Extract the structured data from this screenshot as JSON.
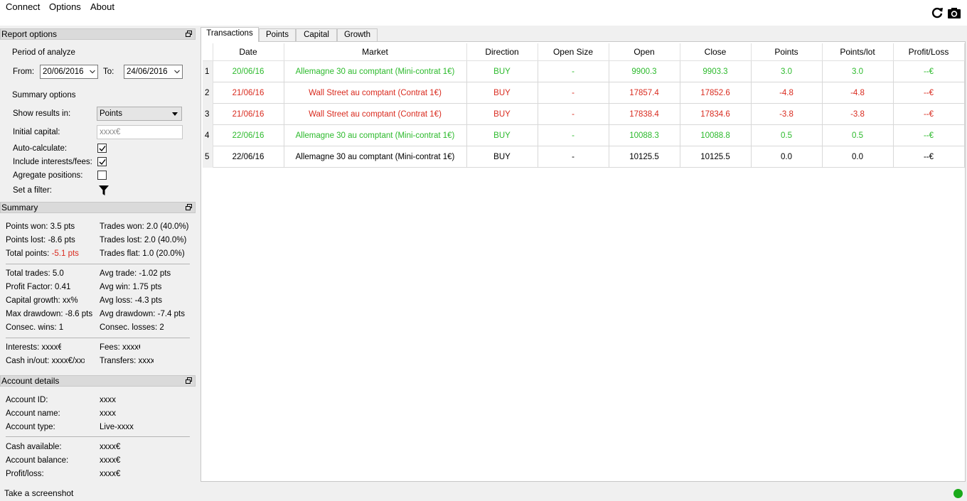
{
  "menu": {
    "connect": "Connect",
    "options": "Options",
    "about": "About"
  },
  "toolbar": {
    "refresh_icon": "refresh-icon",
    "screenshot_icon": "camera-icon"
  },
  "report_options": {
    "header": "Report options",
    "period_label": "Period of analyze",
    "from_label": "From:",
    "from_value": "20/06/2016",
    "to_label": "To:",
    "to_value": "24/06/2016",
    "summary_options_label": "Summary options",
    "show_results_label": "Show results in:",
    "show_results_value": "Points",
    "initial_capital_label": "Initial capital:",
    "initial_capital_placeholder": "xxxx€",
    "auto_calculate_label": "Auto-calculate:",
    "auto_calculate_checked": true,
    "include_interests_label": "Include interests/fees:",
    "include_interests_checked": true,
    "aggregate_label": "Agregate positions:",
    "aggregate_checked": false,
    "filter_label": "Set a filter:"
  },
  "summary": {
    "header": "Summary",
    "points_won": "Points won: 3.5 pts",
    "trades_won": "Trades won: 2.0 (40.0%)",
    "points_lost": "Points lost: -8.6 pts",
    "trades_lost": "Trades lost: 2.0 (40.0%)",
    "total_points_label": "Total points:",
    "total_points_value": "-5.1 pts",
    "trades_flat": "Trades flat: 1.0 (20.0%)",
    "total_trades": "Total trades: 5.0",
    "avg_trade": "Avg trade: -1.02 pts",
    "profit_factor": "Profit Factor: 0.41",
    "avg_win": "Avg win: 1.75 pts",
    "capital_growth": "Capital growth: xx%",
    "avg_loss": "Avg loss: -4.3 pts",
    "max_drawdown": "Max drawdown: -8.6 pts",
    "avg_drawdown": "Avg drawdown: -7.4 pts",
    "consec_wins": "Consec. wins: 1",
    "consec_losses": "Consec. losses: 2",
    "interests": "Interests: xxxx€",
    "fees": "Fees: xxxx€",
    "cash_inout": "Cash in/out: xxxx€/xxxx€",
    "transfers": "Transfers: xxxx€"
  },
  "account": {
    "header": "Account details",
    "id_label": "Account ID:",
    "id_value": "xxxx",
    "name_label": "Account name:",
    "name_value": "xxxx",
    "type_label": "Account type:",
    "type_value": "Live-xxxx",
    "cash_label": "Cash available:",
    "cash_value": "xxxx€",
    "balance_label": "Account balance:",
    "balance_value": "xxxx€",
    "pl_label": "Profit/loss:",
    "pl_value": "xxxx€"
  },
  "tabs": [
    {
      "label": "Transactions",
      "active": true
    },
    {
      "label": "Points",
      "active": false
    },
    {
      "label": "Capital",
      "active": false
    },
    {
      "label": "Growth",
      "active": false
    }
  ],
  "table": {
    "columns": [
      "Date",
      "Market",
      "Direction",
      "Open Size",
      "Open",
      "Close",
      "Points",
      "Points/lot",
      "Profit/Loss"
    ],
    "rows": [
      {
        "num": "1",
        "status": "win",
        "cells": [
          "20/06/16",
          "Allemagne 30 au comptant (Mini-contrat 1€)",
          "BUY",
          "-",
          "9900.3",
          "9903.3",
          "3.0",
          "3.0",
          "--€"
        ]
      },
      {
        "num": "2",
        "status": "loss",
        "cells": [
          "21/06/16",
          "Wall Street au comptant (Contrat 1€)",
          "BUY",
          "-",
          "17857.4",
          "17852.6",
          "-4.8",
          "-4.8",
          "--€"
        ]
      },
      {
        "num": "3",
        "status": "loss",
        "cells": [
          "21/06/16",
          "Wall Street au comptant (Contrat 1€)",
          "BUY",
          "-",
          "17838.4",
          "17834.6",
          "-3.8",
          "-3.8",
          "--€"
        ]
      },
      {
        "num": "4",
        "status": "win",
        "cells": [
          "22/06/16",
          "Allemagne 30 au comptant (Mini-contrat 1€)",
          "BUY",
          "-",
          "10088.3",
          "10088.8",
          "0.5",
          "0.5",
          "--€"
        ]
      },
      {
        "num": "5",
        "status": "flat",
        "cells": [
          "22/06/16",
          "Allemagne 30 au comptant (Mini-contrat 1€)",
          "BUY",
          "-",
          "10125.5",
          "10125.5",
          "0.0",
          "0.0",
          "--€"
        ]
      }
    ]
  },
  "status": {
    "text": "Take a screenshot",
    "indicator_color": "#1aaa1a"
  },
  "colors": {
    "win": "#2cba2c",
    "loss": "#d92b1f",
    "flat": "#000000"
  }
}
